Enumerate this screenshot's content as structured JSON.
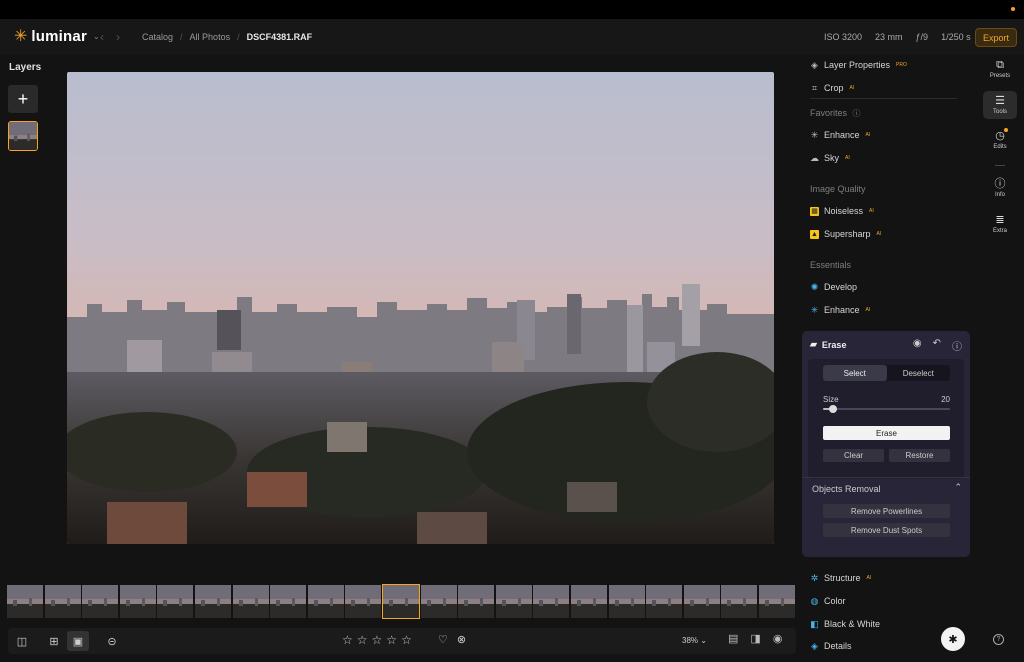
{
  "app": {
    "name": "luminar"
  },
  "colors": {
    "accent": "#f5a623",
    "panel_bg": "#131313",
    "erase_panel_bg": "#272537"
  },
  "header": {
    "breadcrumb": [
      "Catalog",
      "All Photos",
      "DSCF4381.RAF"
    ],
    "meta": {
      "iso": "ISO 3200",
      "focal": "23 mm",
      "aperture": "ƒ/9",
      "shutter": "1/250 s"
    },
    "export_label": "Export"
  },
  "layers": {
    "title": "Layers",
    "add_icon": "plus-icon"
  },
  "tools": {
    "layer_properties": "Layer Properties",
    "layer_properties_badge": "PRO",
    "crop": "Crop",
    "ai_badge": "AI",
    "favorites_title": "Favorites",
    "favorites": [
      "Enhance",
      "Sky"
    ],
    "image_quality_title": "Image Quality",
    "image_quality": [
      "Noiseless",
      "Supersharp"
    ],
    "essentials_title": "Essentials",
    "essentials": [
      "Develop",
      "Enhance"
    ],
    "erase": {
      "title": "Erase",
      "tabs": [
        "Select",
        "Deselect"
      ],
      "active_tab": "Select",
      "size_label": "Size",
      "size_value": "20",
      "size_fraction": 0.08,
      "erase_button": "Erase",
      "clear_button": "Clear",
      "restore_button": "Restore",
      "objects_removal_title": "Objects Removal",
      "remove_powerlines": "Remove Powerlines",
      "remove_dust": "Remove Dust Spots"
    },
    "after": [
      "Structure",
      "Color",
      "Black & White",
      "Details"
    ]
  },
  "rail": [
    {
      "label": "Presets",
      "icon": "presets-icon"
    },
    {
      "label": "Tools",
      "icon": "sliders-icon",
      "active": true
    },
    {
      "label": "Edits",
      "icon": "history-icon"
    },
    {
      "label": "Info",
      "icon": "info-icon"
    },
    {
      "label": "Extra",
      "icon": "list-icon"
    }
  ],
  "bottom": {
    "zoom": "38%",
    "star_count": 5,
    "stars_filled": 0
  }
}
